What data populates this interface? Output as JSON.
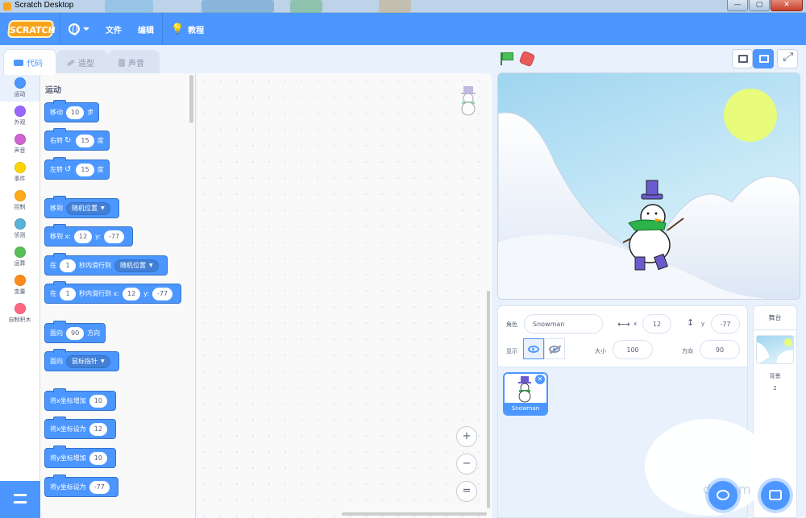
{
  "window": {
    "title": "Scratch Desktop",
    "min": "—",
    "max": "▢",
    "close": "✕"
  },
  "menubar": {
    "logo": "SCRATCH",
    "file": "文件",
    "edit": "编辑",
    "tutorials": "教程"
  },
  "tabs": {
    "code": "代码",
    "costumes": "造型",
    "sounds": "声音"
  },
  "categories": [
    {
      "label": "运动",
      "color": "#4c97ff"
    },
    {
      "label": "外观",
      "color": "#9966ff"
    },
    {
      "label": "声音",
      "color": "#cf63cf"
    },
    {
      "label": "事件",
      "color": "#ffd500"
    },
    {
      "label": "控制",
      "color": "#ffab19"
    },
    {
      "label": "侦测",
      "color": "#5cb1d6"
    },
    {
      "label": "运算",
      "color": "#59c059"
    },
    {
      "label": "变量",
      "color": "#ff8c1a"
    },
    {
      "label": "自制积木",
      "color": "#ff6680"
    }
  ],
  "palette": {
    "section": "运动",
    "move": {
      "a": "移动",
      "v": "10",
      "b": "步"
    },
    "turn_right": {
      "a": "右转",
      "icon": "↻",
      "v": "15",
      "b": "度"
    },
    "turn_left": {
      "a": "左转",
      "icon": "↺",
      "v": "15",
      "b": "度"
    },
    "goto": {
      "a": "移到",
      "d": "随机位置"
    },
    "goto_xy": {
      "a": "移到 x:",
      "x": "12",
      "b": "y:",
      "y": "-77"
    },
    "glide": {
      "a": "在",
      "v": "1",
      "b": "秒内滑行到",
      "d": "随机位置"
    },
    "glide_xy": {
      "a": "在",
      "v": "1",
      "b": "秒内滑行到 x:",
      "x": "12",
      "c": "y:",
      "y": "-77"
    },
    "point_dir": {
      "a": "面向",
      "v": "90",
      "b": "方向"
    },
    "point_towards": {
      "a": "面向",
      "d": "鼠标指针"
    },
    "change_x": {
      "a": "将x坐标增加",
      "v": "10"
    },
    "set_x": {
      "a": "将x坐标设为",
      "v": "12"
    },
    "change_y": {
      "a": "将y坐标增加",
      "v": "10"
    },
    "set_y": {
      "a": "将y坐标设为",
      "v": "-77"
    }
  },
  "zoom": {
    "in": "+",
    "out": "−",
    "reset": "="
  },
  "sprite_info": {
    "sprite_label": "角色",
    "sprite_name": "Snowman",
    "x_label": "x",
    "x": "12",
    "y_label": "y",
    "y": "-77",
    "show_label": "显示",
    "size_label": "大小",
    "size": "100",
    "dir_label": "方向",
    "direction": "90"
  },
  "sprites": [
    {
      "name": "Snowman"
    }
  ],
  "stage_panel": {
    "title": "舞台",
    "backdrop_label": "背景",
    "backdrop_count": "2"
  },
  "watermark": "du.com"
}
